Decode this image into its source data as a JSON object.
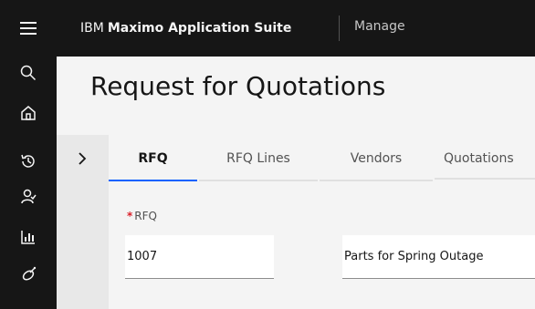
{
  "header": {
    "brand_prefix": "IBM",
    "brand_name": "Maximo Application Suite",
    "app_name": "Manage"
  },
  "sidebar": {
    "icons": [
      "menu-icon",
      "search-icon",
      "home-icon",
      "history-icon",
      "person-icon",
      "chart-icon",
      "satellite-icon"
    ]
  },
  "page": {
    "title": "Request for Quotations"
  },
  "tabs": [
    {
      "label": "RFQ",
      "active": true
    },
    {
      "label": "RFQ Lines",
      "active": false
    },
    {
      "label": "Vendors",
      "active": false
    },
    {
      "label": "Quotations",
      "active": false
    }
  ],
  "form": {
    "rfq_required_marker": "*",
    "rfq_label": "RFQ",
    "rfq_value": "1007",
    "description_value": "Parts for Spring Outage"
  },
  "colors": {
    "accent": "#0f62fe",
    "required": "#da1e28",
    "shell": "#161616"
  }
}
